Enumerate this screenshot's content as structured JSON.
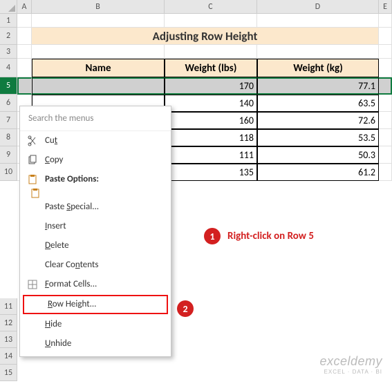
{
  "columns": [
    "A",
    "B",
    "C",
    "D",
    "E"
  ],
  "rows": [
    "1",
    "2",
    "3",
    "4",
    "5",
    "6",
    "7",
    "8",
    "9",
    "10",
    "11",
    "12",
    "13",
    "14",
    "15"
  ],
  "title": "Adjusting Row Height",
  "headers": {
    "name": "Name",
    "wl": "Weight (lbs)",
    "wk": "Weight (kg)"
  },
  "data": [
    {
      "wl": "170",
      "wk": "77.1"
    },
    {
      "wl": "140",
      "wk": "63.5"
    },
    {
      "wl": "160",
      "wk": "72.6"
    },
    {
      "wl": "118",
      "wk": "53.5"
    },
    {
      "wl": "111",
      "wk": "50.3"
    },
    {
      "wl": "135",
      "wk": "61.2"
    }
  ],
  "menu": {
    "search": "Search the menus",
    "cut_pre": "Cu",
    "cut_u": "t",
    "copy_u": "C",
    "copy_post": "opy",
    "paste_u": "Paste Options:",
    "ps_pre": "Paste ",
    "ps_u": "S",
    "ps_post": "pecial...",
    "insert_u": "I",
    "insert_post": "nsert",
    "delete_u": "D",
    "delete_post": "elete",
    "clear_pre": "Clear Co",
    "clear_u": "n",
    "clear_post": "tents",
    "fmt_u": "F",
    "fmt_post": "ormat Cells...",
    "rh_u": "R",
    "rh_post": "ow Height...",
    "hide_u": "H",
    "hide_post": "ide",
    "unhide_u": "U",
    "unhide_post": "nhide"
  },
  "callouts": {
    "one": "1",
    "one_text": "Right-click on Row 5",
    "two": "2"
  },
  "watermark": {
    "line1": "exceldemy",
    "line2": "EXCEL · DATA · BI"
  }
}
